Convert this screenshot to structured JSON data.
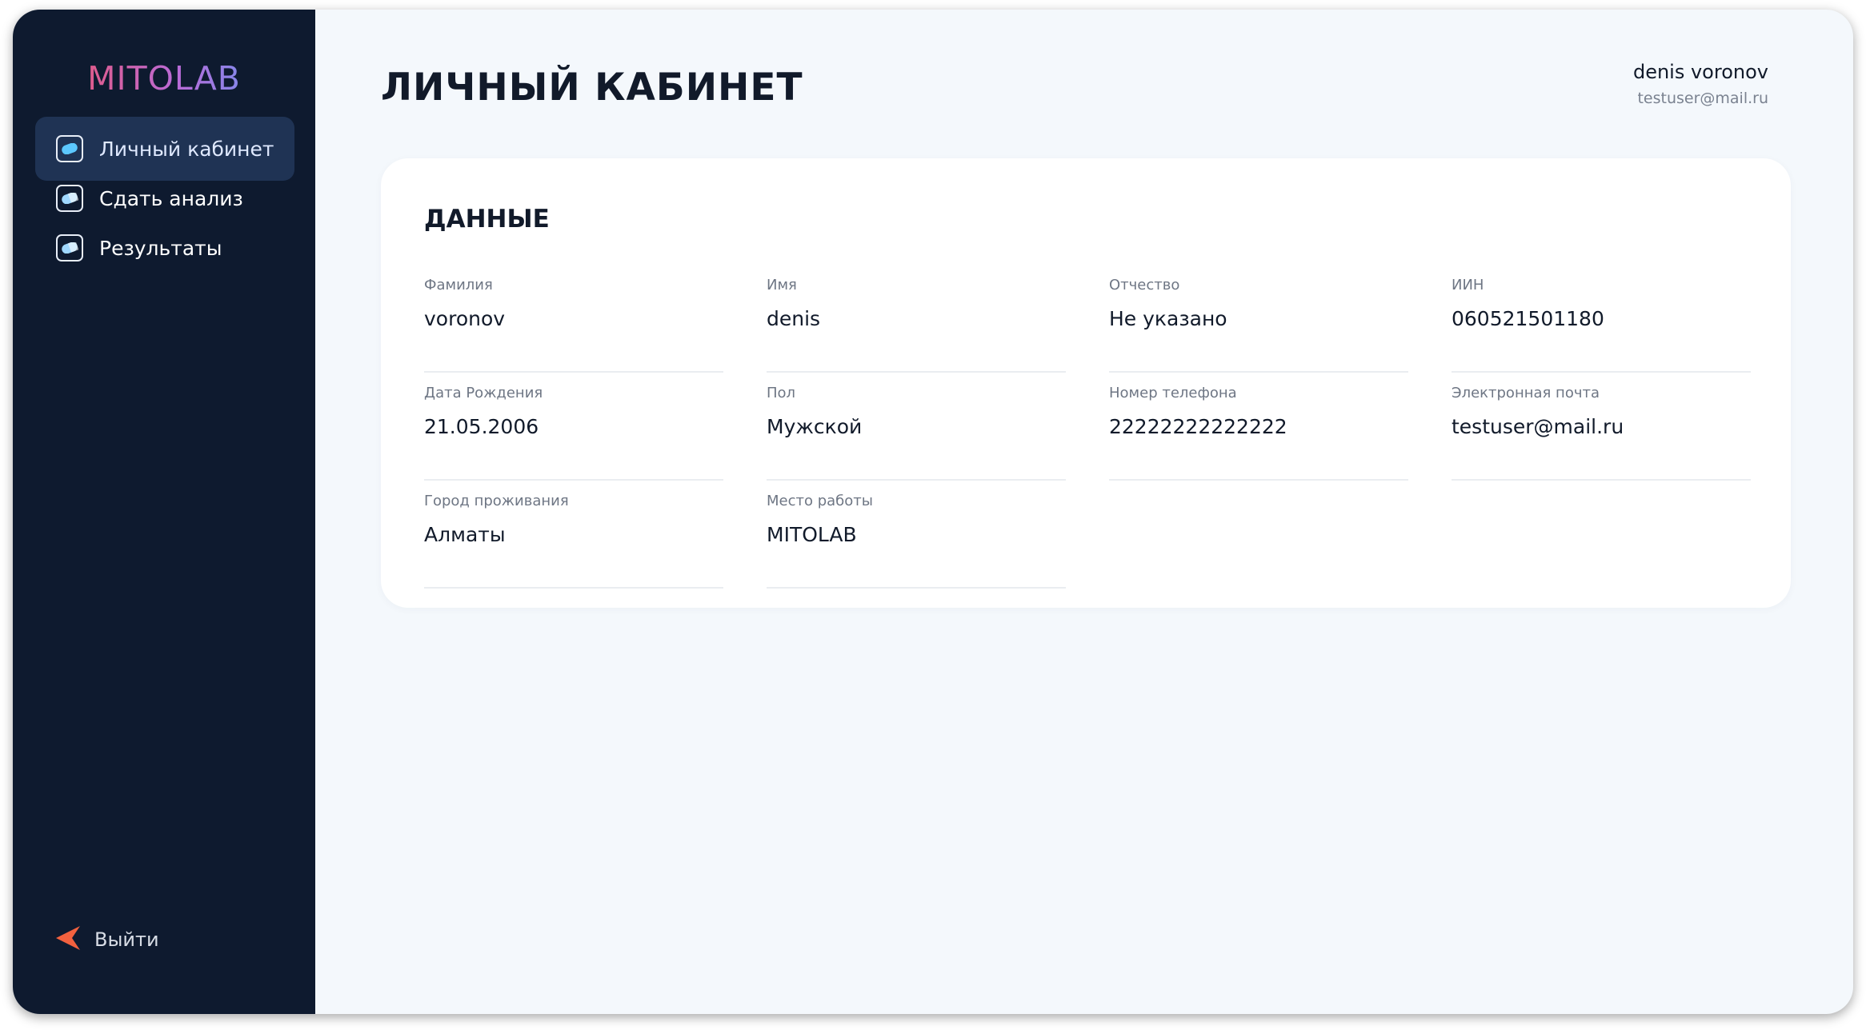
{
  "sidebar": {
    "logo": "MITOLAB",
    "nav_items": [
      {
        "label": "Личный кабинет",
        "active": true
      },
      {
        "label": "Сдать анализ",
        "active": false
      },
      {
        "label": "Результаты",
        "active": false
      }
    ],
    "logout_label": "Выйти"
  },
  "header": {
    "title": "ЛИЧНЫЙ КАБИНЕТ",
    "user_name": "denis voronov",
    "user_email": "testuser@mail.ru"
  },
  "card": {
    "title": "ДАННЫЕ",
    "fields": [
      {
        "label": "Фамилия",
        "value": "voronov"
      },
      {
        "label": "Имя",
        "value": "denis"
      },
      {
        "label": "Отчество",
        "value": "Не указано"
      },
      {
        "label": "ИИН",
        "value": "060521501180"
      },
      {
        "label": "Дата Рождения",
        "value": "21.05.2006"
      },
      {
        "label": "Пол",
        "value": "Мужской"
      },
      {
        "label": "Номер телефона",
        "value": "22222222222222"
      },
      {
        "label": "Электронная почта",
        "value": "testuser@mail.ru"
      },
      {
        "label": "Город проживания",
        "value": "Алматы"
      },
      {
        "label": "Место работы",
        "value": "MITOLAB"
      }
    ]
  },
  "colors": {
    "sidebar_bg": "#0e1a2f",
    "active_item_bg": "#1f3354",
    "main_bg": "#f4f8fc",
    "card_bg": "#ffffff",
    "logout_accent": "#f2613f",
    "icon_accent": "#5cc8ff"
  },
  "icons": {
    "nav": "pill-icon",
    "logout": "arrow-left-icon"
  }
}
